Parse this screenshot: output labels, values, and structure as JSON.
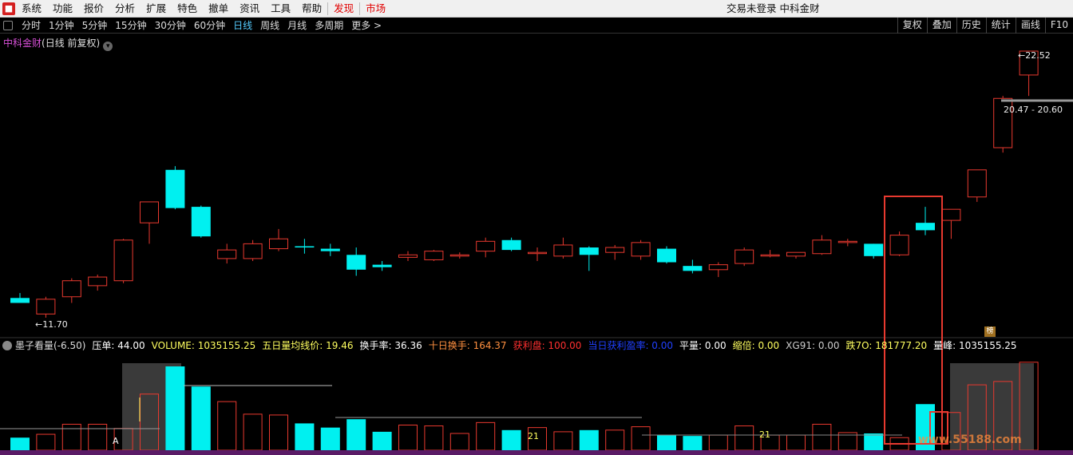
{
  "menubar": {
    "logo": "■",
    "items": [
      "系统",
      "功能",
      "报价",
      "分析",
      "扩展",
      "特色",
      "撤单",
      "资讯",
      "工具",
      "帮助"
    ],
    "highlight_items": [
      "发现",
      "市场"
    ],
    "title": "交易未登录 中科金财"
  },
  "periodbar": {
    "periods": [
      "分时",
      "1分钟",
      "5分钟",
      "15分钟",
      "30分钟",
      "60分钟",
      "日线",
      "周线",
      "月线",
      "多周期",
      "更多 >"
    ],
    "active": "日线",
    "tools": [
      "复权",
      "叠加",
      "历史",
      "统计",
      "画线",
      "F10"
    ]
  },
  "stock": {
    "name": "中科金财",
    "mode": "(日线 前复权)"
  },
  "price_labels": {
    "low": "←11.70",
    "high": "←22.52",
    "range": "20.47 - 20.60"
  },
  "badge": "榜",
  "indicator": {
    "name": "墨子看量(-6.50)",
    "items": [
      {
        "text": "压单: 44.00",
        "color": "#ffffff"
      },
      {
        "text": "VOLUME: 1035155.25",
        "color": "#ffff60"
      },
      {
        "text": "五日量均线价: 19.46",
        "color": "#ffff60"
      },
      {
        "text": "换手率: 36.36",
        "color": "#ffffff"
      },
      {
        "text": "十日换手: 164.37",
        "color": "#ff9040"
      },
      {
        "text": "获利盘: 100.00",
        "color": "#ff3030"
      },
      {
        "text": "当日获利盈率: 0.00",
        "color": "#2040ff"
      },
      {
        "text": "平量: 0.00",
        "color": "#ffffff"
      },
      {
        "text": "缩倍: 0.00",
        "color": "#ffff60"
      },
      {
        "text": "XG91: 0.00",
        "color": "#cccccc"
      },
      {
        "text": "跌7O: 181777.20",
        "color": "#ffff60"
      },
      {
        "text": "量峰: 1035155.25",
        "color": "#ffffff"
      }
    ]
  },
  "volume_marks": [
    "A",
    "21",
    "21"
  ],
  "watermark": "www.55188.com",
  "colors": {
    "up": "#e8392f",
    "down": "#00f0f0",
    "highlight": "#e8392f"
  },
  "chart_data": {
    "type": "candlestick",
    "price_low": 11.7,
    "price_high": 22.52,
    "candles": [
      {
        "o": 12.5,
        "h": 12.7,
        "l": 12.35,
        "c": 12.3
      },
      {
        "o": 11.85,
        "h": 12.55,
        "l": 11.7,
        "c": 12.45
      },
      {
        "o": 12.55,
        "h": 13.3,
        "l": 12.3,
        "c": 13.2
      },
      {
        "o": 13.0,
        "h": 13.45,
        "l": 12.8,
        "c": 13.35
      },
      {
        "o": 13.2,
        "h": 14.9,
        "l": 13.1,
        "c": 14.85
      },
      {
        "o": 15.55,
        "h": 16.4,
        "l": 14.7,
        "c": 16.4
      },
      {
        "o": 17.7,
        "h": 17.85,
        "l": 16.1,
        "c": 16.15
      },
      {
        "o": 16.2,
        "h": 16.25,
        "l": 14.95,
        "c": 15.0
      },
      {
        "o": 14.1,
        "h": 14.7,
        "l": 13.9,
        "c": 14.45
      },
      {
        "o": 14.1,
        "h": 14.85,
        "l": 14.0,
        "c": 14.7
      },
      {
        "o": 14.5,
        "h": 15.3,
        "l": 14.4,
        "c": 14.9
      },
      {
        "o": 14.6,
        "h": 14.9,
        "l": 14.3,
        "c": 14.55
      },
      {
        "o": 14.5,
        "h": 14.7,
        "l": 14.2,
        "c": 14.4
      },
      {
        "o": 14.25,
        "h": 14.55,
        "l": 13.4,
        "c": 13.65
      },
      {
        "o": 13.85,
        "h": 14.0,
        "l": 13.6,
        "c": 13.75
      },
      {
        "o": 14.15,
        "h": 14.4,
        "l": 14.0,
        "c": 14.25
      },
      {
        "o": 14.05,
        "h": 14.45,
        "l": 14.0,
        "c": 14.4
      },
      {
        "o": 14.2,
        "h": 14.35,
        "l": 14.1,
        "c": 14.25
      },
      {
        "o": 14.4,
        "h": 14.95,
        "l": 14.15,
        "c": 14.8
      },
      {
        "o": 14.85,
        "h": 14.95,
        "l": 14.4,
        "c": 14.45
      },
      {
        "o": 14.35,
        "h": 14.55,
        "l": 14.0,
        "c": 14.35
      },
      {
        "o": 14.2,
        "h": 14.95,
        "l": 14.1,
        "c": 14.65
      },
      {
        "o": 14.55,
        "h": 14.6,
        "l": 13.6,
        "c": 14.25
      },
      {
        "o": 14.35,
        "h": 14.65,
        "l": 14.05,
        "c": 14.55
      },
      {
        "o": 14.2,
        "h": 14.85,
        "l": 14.05,
        "c": 14.75
      },
      {
        "o": 14.5,
        "h": 14.6,
        "l": 13.9,
        "c": 13.95
      },
      {
        "o": 13.8,
        "h": 14.05,
        "l": 13.5,
        "c": 13.6
      },
      {
        "o": 13.65,
        "h": 13.95,
        "l": 13.35,
        "c": 13.85
      },
      {
        "o": 13.9,
        "h": 14.55,
        "l": 13.8,
        "c": 14.45
      },
      {
        "o": 14.25,
        "h": 14.45,
        "l": 14.15,
        "c": 14.25
      },
      {
        "o": 14.2,
        "h": 14.35,
        "l": 14.1,
        "c": 14.35
      },
      {
        "o": 14.3,
        "h": 15.05,
        "l": 14.25,
        "c": 14.85
      },
      {
        "o": 14.75,
        "h": 14.9,
        "l": 14.6,
        "c": 14.8
      },
      {
        "o": 14.7,
        "h": 14.7,
        "l": 14.1,
        "c": 14.2
      },
      {
        "o": 14.25,
        "h": 15.2,
        "l": 14.2,
        "c": 15.05
      },
      {
        "o": 15.55,
        "h": 16.2,
        "l": 15.05,
        "c": 15.25
      },
      {
        "o": 15.65,
        "h": 16.1,
        "l": 14.9,
        "c": 16.1
      },
      {
        "o": 16.6,
        "h": 17.7,
        "l": 16.4,
        "c": 17.7
      },
      {
        "o": 18.6,
        "h": 20.7,
        "l": 18.4,
        "c": 20.6
      },
      {
        "o": 21.55,
        "h": 22.52,
        "l": 20.7,
        "c": 22.52
      }
    ],
    "volume_max": 1035155.25,
    "volumes": [
      0.15,
      0.19,
      0.31,
      0.31,
      0.26,
      0.67,
      1.0,
      0.76,
      0.58,
      0.43,
      0.42,
      0.32,
      0.27,
      0.37,
      0.22,
      0.3,
      0.29,
      0.2,
      0.33,
      0.24,
      0.27,
      0.22,
      0.24,
      0.24,
      0.28,
      0.18,
      0.17,
      0.18,
      0.29,
      0.18,
      0.18,
      0.31,
      0.21,
      0.2,
      0.15,
      0.55,
      0.45,
      0.78,
      0.82,
      1.05
    ]
  }
}
